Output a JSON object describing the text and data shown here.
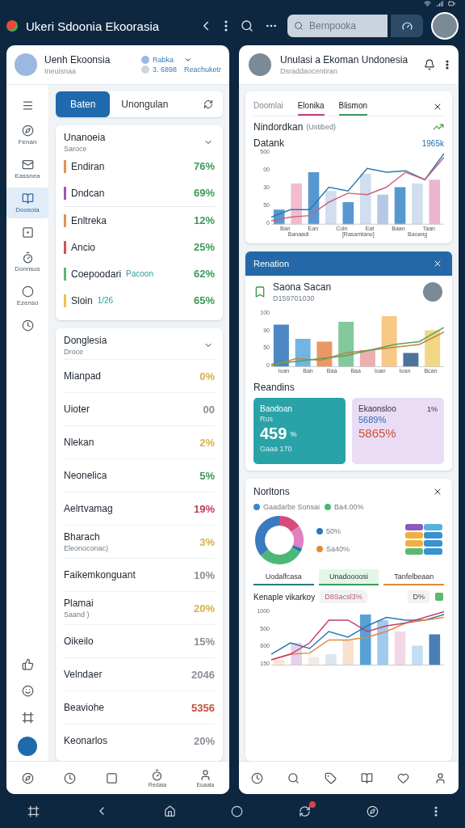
{
  "app_bar": {
    "title": "Ukeri Sdoonia Ekoorasia",
    "search": {
      "placeholder": "Bernpooka"
    }
  },
  "left_panel": {
    "header": {
      "title": "Uenh Ekoonsia",
      "subtitle": "Ineuisnaa",
      "legend": [
        {
          "label": "Rabka",
          "color": "#9bb8e0"
        },
        {
          "label": "3. 6898",
          "color": "#cfd4da"
        }
      ],
      "extra": "Reachuketr"
    },
    "sidebar": [
      {
        "selected": false
      },
      {
        "label": "Fenan",
        "selected": false
      },
      {
        "label": "Eassnea",
        "selected": false
      },
      {
        "label": "Doosola",
        "selected": true
      },
      {
        "selected": false
      },
      {
        "label": "Donnsus",
        "selected": false
      },
      {
        "label": "Ezenso",
        "selected": false
      },
      {
        "selected": false
      }
    ],
    "segments": [
      {
        "label": "Baten",
        "selected": true
      },
      {
        "label": "Unongulan",
        "selected": false
      }
    ],
    "summary_card": {
      "title": "Unanoeia",
      "subtitle": "Saroce",
      "groups": [
        [
          {
            "name": "Endiran",
            "value": "76%",
            "color": "#e0935a"
          },
          {
            "name": "Dndcan",
            "value": "69%",
            "color": "#9b59b6"
          }
        ],
        [
          {
            "name": "Enltreka",
            "value": "12%",
            "color": "#e0935a"
          },
          {
            "name": "Ancio",
            "value": "25%",
            "color": "#d35454"
          },
          {
            "name": "Coepoodari",
            "tag": "Pacoon",
            "value": "62%",
            "color": "#5cb870"
          },
          {
            "name": "Sloin",
            "tag": "1/26",
            "value": "65%",
            "color": "#f0c050"
          }
        ]
      ]
    },
    "list_card": {
      "title": "Donglesia",
      "subtitle": "Droce",
      "rows": [
        {
          "name": "Mianpad",
          "value": "0%",
          "color": "#d9b04a"
        },
        {
          "name": "Uioter",
          "value": "00",
          "color": "#8a9099"
        },
        {
          "name": "Nlekan",
          "value": "2%",
          "color": "#d9b04a"
        },
        {
          "name": "Neonelica",
          "value": "5%",
          "color": "#3c9a5a"
        },
        {
          "name": "Aelrtvamag",
          "value": "19%",
          "color": "#c0405a"
        },
        {
          "name": "Bharach",
          "sub": "Eleonoconac)",
          "value": "3%",
          "color": "#d9b04a"
        },
        {
          "name": "Faikemkonguant",
          "value": "10%",
          "color": "#8a9099"
        },
        {
          "name": "Plamai",
          "sub": "Saand )",
          "value": "20%",
          "color": "#d9b04a"
        },
        {
          "name": "Oikeilo",
          "value": "15%",
          "color": "#8a9099"
        },
        {
          "name": "Velndaer",
          "value": "2046",
          "color": "#8a9099"
        },
        {
          "name": "Beaviohe",
          "value": "5356",
          "color": "#c0503a"
        },
        {
          "name": "Keonarlos",
          "value": "20%",
          "color": "#8a9099"
        }
      ]
    },
    "bottom_nav_labels": [
      "Redaia",
      "Euaala"
    ]
  },
  "right_panel": {
    "header": {
      "title": "Unulasi a Ekoman Undonesia",
      "subtitle": "Dsraddaocentiran"
    },
    "chart_card": {
      "tabs": [
        {
          "label": "Doomlai",
          "selected": false
        },
        {
          "label": "Elonika",
          "selected": true,
          "color": "#c0407a"
        },
        {
          "label": "Blismon",
          "selected": true,
          "color": "#3c9a5a"
        }
      ],
      "title": "Nindordkan",
      "note": "(Ustibed)",
      "label": "Datank",
      "value": "1965k",
      "y_labels": [
        "500",
        "00",
        "30",
        "50",
        "0"
      ],
      "x_labels": [
        "Ban",
        "Ean",
        "Coln",
        "Eat",
        "Baan",
        "Taan"
      ],
      "x_groups": [
        "Banaadi",
        "[Rasamtanu]",
        "Baoang"
      ]
    },
    "report_card": {
      "title": "Renation",
      "name": "Saona Sacan",
      "code": "D159701030",
      "y_labels": [
        "100",
        "90",
        "50",
        "0"
      ],
      "x_labels": [
        "Ioan",
        "Ban",
        "Baa",
        "Baa",
        "Ioan",
        "Ioan",
        "Bcan"
      ],
      "section": "Reandins",
      "tiles": [
        {
          "title": "Baodoan",
          "caption": "Rus",
          "value": "459",
          "unit": "%",
          "footer": "Gaaa 170",
          "color": "#2aa3a8"
        },
        {
          "title": "Ekaonsloo",
          "badge": "1%",
          "line_1": "5689%",
          "line_2": "5865%",
          "color": "#eadcf5"
        }
      ]
    },
    "mix_card": {
      "title": "Norltons",
      "legend": [
        {
          "label": "Gaadarbe Sonsai",
          "color": "#3a86c8"
        },
        {
          "label": "Ba4.00%",
          "color": "#4cb878"
        },
        {
          "label": "50%",
          "color": "#2a78c0"
        },
        {
          "label": "Sa40%",
          "color": "#e08a3c"
        }
      ],
      "tabs": [
        {
          "label": "Uodalfcasa",
          "selected": false,
          "color": "#2a7a80"
        },
        {
          "label": "Unadoooosi",
          "selected": true,
          "color": "#3c9a5a"
        },
        {
          "label": "Tanfelbeaan",
          "selected": false,
          "color": "#e08a3c"
        }
      ],
      "label": "Kenaple vikarkoy",
      "chip_1": "D8Sacsl3%",
      "chip_2": "D%",
      "y_labels": [
        "1000",
        "500",
        "600",
        "150"
      ]
    }
  }
}
